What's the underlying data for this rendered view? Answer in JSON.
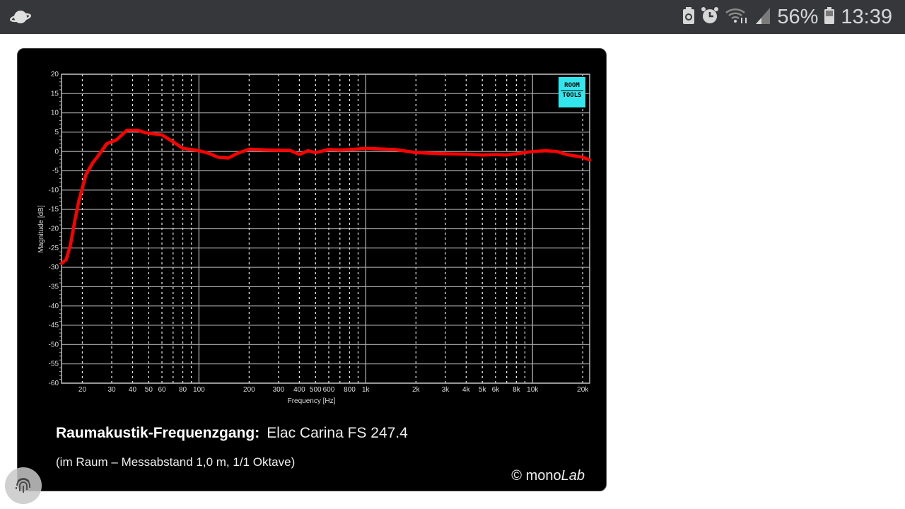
{
  "status_bar": {
    "battery_percent": "56%",
    "time": "13:39",
    "icons": [
      "app-planet-icon",
      "battery-saver-icon",
      "alarm-icon",
      "wifi-icon",
      "signal-icon",
      "battery-icon"
    ]
  },
  "card": {
    "title_bold": "Raumakustik-Frequenzgang:",
    "title_model": "Elac Carina FS 247.4",
    "subtitle": "(im Raum – Messabstand 1,0 m, 1/1 Oktave)",
    "credit_prefix": "© mono",
    "credit_italic": "Lab",
    "logo_line1": "ROOM",
    "logo_line2": "TOOLS"
  },
  "colors": {
    "curve": "#ff0000",
    "background": "#000000",
    "grid": "#bbbbbb",
    "logo": "#33e6ee"
  },
  "chart_data": {
    "type": "line",
    "title": "Raumakustik-Frequenzgang: Elac Carina FS 247.4",
    "xlabel": "Frequency [Hz]",
    "ylabel": "Magnitude [dB]",
    "xscale": "log",
    "xlim": [
      15,
      22000
    ],
    "ylim": [
      -60,
      20
    ],
    "grid": true,
    "x_ticks": [
      20,
      30,
      40,
      50,
      60,
      80,
      100,
      200,
      300,
      400,
      500,
      600,
      800,
      1000,
      2000,
      3000,
      4000,
      5000,
      6000,
      8000,
      10000,
      20000
    ],
    "x_tick_labels": [
      "20",
      "30",
      "40",
      "50",
      "60",
      "80",
      "100",
      "200",
      "300",
      "400",
      "500",
      "600",
      "800",
      "1k",
      "2k",
      "3k",
      "4k",
      "5k",
      "6k",
      "8k",
      "10k",
      "20k"
    ],
    "y_ticks": [
      20,
      15,
      10,
      5,
      0,
      -5,
      -10,
      -15,
      -20,
      -25,
      -30,
      -35,
      -40,
      -45,
      -50,
      -55,
      -60
    ],
    "y_tick_labels": [
      "20",
      "15",
      "10",
      "5",
      "0",
      "-5",
      "-10",
      "-15",
      "-20",
      "-25",
      "-30",
      "-35",
      "-40",
      "-45",
      "-50",
      "-55",
      "-60"
    ],
    "series": [
      {
        "name": "Elac Carina FS 247.4",
        "x": [
          15,
          16,
          17,
          18,
          19,
          21,
          23,
          25,
          28,
          32,
          37,
          43,
          48,
          55,
          60,
          70,
          80,
          90,
          100,
          115,
          130,
          150,
          170,
          200,
          250,
          300,
          350,
          400,
          450,
          500,
          600,
          700,
          800,
          1000,
          1500,
          2000,
          3000,
          4000,
          5000,
          6000,
          7000,
          8000,
          10000,
          12000,
          14000,
          16000,
          20000,
          22000
        ],
        "y": [
          -29,
          -28,
          -24,
          -18,
          -13,
          -6,
          -3,
          -1,
          2,
          3,
          5.5,
          5.5,
          4.8,
          4.5,
          4.3,
          2.5,
          0.8,
          0.5,
          0.2,
          -0.5,
          -1.5,
          -1.7,
          -0.5,
          0.6,
          0.4,
          0.3,
          0.3,
          -0.8,
          0.2,
          -0.3,
          0.5,
          0.4,
          0.5,
          0.8,
          0.5,
          -0.3,
          -0.6,
          -0.7,
          -0.9,
          -0.8,
          -0.9,
          -0.6,
          0,
          0.2,
          0,
          -0.8,
          -1.5,
          -2.2
        ]
      }
    ]
  }
}
